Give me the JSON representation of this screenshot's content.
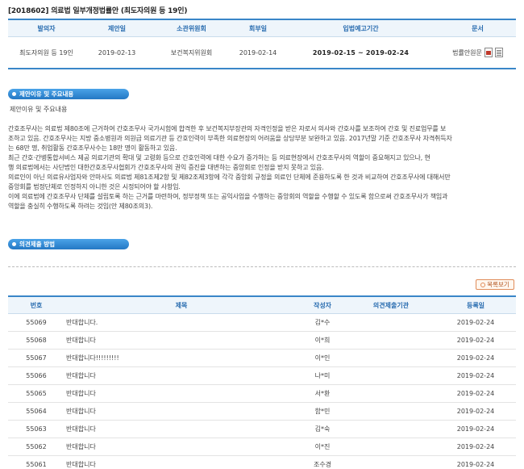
{
  "title": "[2018602] 의료법 일부개정법률안 (최도자의원 등 19인)",
  "bill": {
    "headers": [
      "발의자",
      "제안일",
      "소관위원회",
      "회부일",
      "입법예고기간",
      "문서"
    ],
    "proposer": "최도자의원 등 19인",
    "proposal_date": "2019-02-13",
    "committee": "보건복지위원회",
    "referral_date": "2019-02-14",
    "notice_period": "2019-02-15 ~ 2019-02-24",
    "document": "법률안원문"
  },
  "reason_section": {
    "badge": "제안이유 및 주요내용",
    "label": "제안이유 및 주요내용",
    "paragraphs": [
      "간호조무사는 의료법 제80조에 근거하여 간호조무사 국가시험에 합격한 후 보건복지부장관의 자격인정을 받은 자로서 의사와 간호사를 보조하여 간호 및 진료업무를 보",
      "조하고 있음. 간호조무사는 지방 중소병원과 의원급 의료기관 등 간호인력이 부족한 의료현장의 어려움을 상당부분 보완하고 있음. 2017년말 기준 간호조무사 자격취득자",
      "는 68만 명, 취업활동 간호조무사수는 18만 명이 활동하고 있음.",
      "최근 간호·간병통합서비스 제공 의료기관의 확대 및 고령화 등으로 간호인력에 대한 수요가 증가하는 등 의료현장에서 간호조무사의 역할이 중요해지고 있으나, 현",
      "행 의료법에서는 사단법인 대한간호조무사협회가 간호조무사의 권익 증진을 대변하는 중앙회로 인정을 받지 못하고 있음.",
      "의료인이 아닌 의료유사업자와 안마사도 의료법 제81조제2항 및 제82조제3항에 각각 중앙회 규정을 의료인 단체에 준용하도록 한 것과 비교하여 간호조무사에 대해서만",
      "중앙회를 법정단체로 인정하지 아니한 것은 시정되어야 할 사항임.",
      "이에 의료법에 간호조무사 단체를 설립토록 하는 근거를 마련하여, 정부정책 또는 공익사업을 수행하는 중앙회의 역할을 수행할 수 있도록 함으로써 간호조무사가 책임과",
      "역할을 충실히 수행하도록 하려는 것임(안 제80조의3)."
    ]
  },
  "opinion_section": {
    "badge": "의견제출 방법",
    "list_button": "목록보기",
    "headers": [
      "번호",
      "제목",
      "작성자",
      "의견제출기관",
      "등록일"
    ],
    "rows": [
      {
        "no": "55069",
        "title": "반대합니다.",
        "author": "김*수",
        "org": "",
        "date": "2019-02-24"
      },
      {
        "no": "55068",
        "title": "반대합니다",
        "author": "이*희",
        "org": "",
        "date": "2019-02-24"
      },
      {
        "no": "55067",
        "title": "반대합니다!!!!!!!!!",
        "author": "이*인",
        "org": "",
        "date": "2019-02-24"
      },
      {
        "no": "55066",
        "title": "반대합니다",
        "author": "나*미",
        "org": "",
        "date": "2019-02-24"
      },
      {
        "no": "55065",
        "title": "반대합니다",
        "author": "서*환",
        "org": "",
        "date": "2019-02-24"
      },
      {
        "no": "55064",
        "title": "반대합니다",
        "author": "함*민",
        "org": "",
        "date": "2019-02-24"
      },
      {
        "no": "55063",
        "title": "반대합니다",
        "author": "김*숙",
        "org": "",
        "date": "2019-02-24"
      },
      {
        "no": "55062",
        "title": "반대합니다",
        "author": "이*진",
        "org": "",
        "date": "2019-02-24"
      },
      {
        "no": "55061",
        "title": "반대합니다",
        "author": "조수경",
        "org": "",
        "date": "2019-02-24"
      }
    ]
  },
  "colors": {
    "accent": "#3a86c8",
    "header_bg": "#eef5fb",
    "header_text": "#2a6db0"
  }
}
